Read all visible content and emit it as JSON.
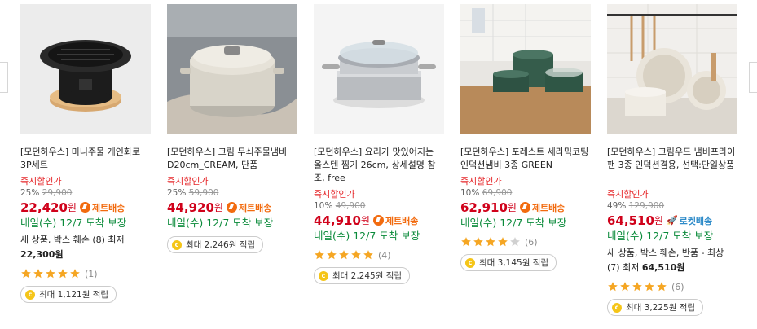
{
  "instant_label": "즉시할인가",
  "products": [
    {
      "title": "[모던하우스] 미니주물 개인화로 3P세트",
      "discount": "25%",
      "original_price": "29,900",
      "price": "22,420",
      "currency": "원",
      "badge": "제트배송",
      "badge_type": "jet",
      "delivery": "내일(수) 12/7 도착 보장",
      "extra": [
        "새 상품, 박스 훼손 (8) 최저 ",
        "22,300원"
      ],
      "rating": 5,
      "review_count": "(1)",
      "reward": "최대 1,121원 적립"
    },
    {
      "title": "[모던하우스] 크림 무쇠주물냄비D20cm_CREAM, 단품",
      "discount": "25%",
      "original_price": "59,900",
      "price": "44,920",
      "currency": "원",
      "badge": "제트배송",
      "badge_type": "jet",
      "delivery": "내일(수) 12/7 도착 보장",
      "reward": "최대 2,246원 적립"
    },
    {
      "title": "[모던하우스] 요리가 맛있어지는 올스텐 찜기 26cm, 상세설명 참조, free",
      "discount": "10%",
      "original_price": "49,900",
      "price": "44,910",
      "currency": "원",
      "badge": "제트배송",
      "badge_type": "jet",
      "delivery": "내일(수) 12/7 도착 보장",
      "rating": 5,
      "review_count": "(4)",
      "reward": "최대 2,245원 적립"
    },
    {
      "title": "[모던하우스] 포레스트 세라믹코팅 인덕션냄비 3종 GREEN",
      "discount": "10%",
      "original_price": "69,900",
      "price": "62,910",
      "currency": "원",
      "badge": "제트배송",
      "badge_type": "jet",
      "delivery": "내일(수) 12/7 도착 보장",
      "rating": 4,
      "review_count": "(6)",
      "reward": "최대 3,145원 적립"
    },
    {
      "title": "[모던하우스] 크림우드 냄비프라이팬 3종 인덕션겸용, 선택:단일상품",
      "discount": "49%",
      "original_price": "129,900",
      "price": "64,510",
      "currency": "원",
      "badge": "로켓배송",
      "badge_type": "rocket",
      "delivery": "내일(수) 12/7 도착 보장",
      "extra": [
        "새 상품, 박스 훼손, 반품 - 최상 (7) 최저 ",
        "64,510원"
      ],
      "rating": 5,
      "review_count": "(6)",
      "reward": "최대 3,225원 적립"
    }
  ]
}
